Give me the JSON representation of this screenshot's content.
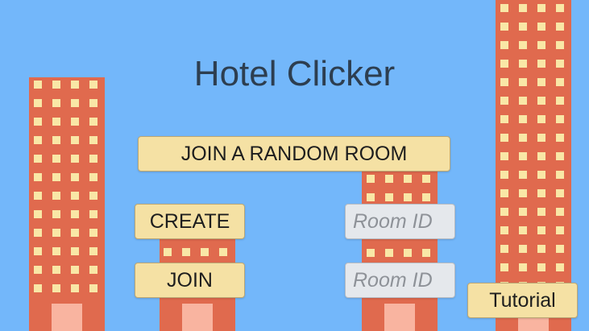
{
  "app": {
    "title": "Hotel Clicker"
  },
  "buttons": {
    "join_random": "JOIN A RANDOM ROOM",
    "create": "CREATE",
    "join": "JOIN",
    "tutorial": "Tutorial"
  },
  "inputs": {
    "create_room_id": {
      "placeholder": "Room ID",
      "value": ""
    },
    "join_room_id": {
      "placeholder": "Room ID",
      "value": ""
    }
  },
  "colors": {
    "sky": "#73b7fa",
    "building": "#e06a4e",
    "window": "#f9e7a6",
    "door": "#f9b4a0",
    "button": "#f5e1a4",
    "input": "#e5e8ec",
    "title": "#2d3e50"
  }
}
